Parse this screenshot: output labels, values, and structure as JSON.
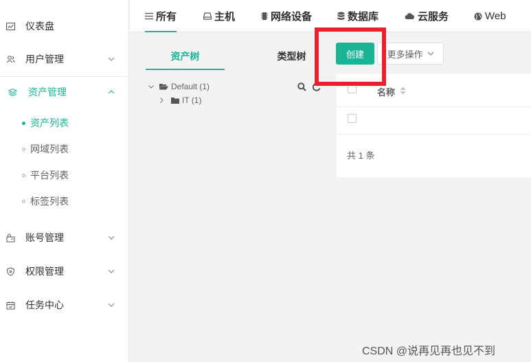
{
  "sidebar": {
    "items": [
      {
        "label": "仪表盘",
        "icon": "dashboard-icon",
        "expandable": false
      },
      {
        "label": "用户管理",
        "icon": "users-icon",
        "expandable": true
      },
      {
        "label": "资产管理",
        "icon": "layers-icon",
        "expandable": true,
        "expanded": true,
        "active": true
      },
      {
        "label": "账号管理",
        "icon": "account-icon",
        "expandable": true
      },
      {
        "label": "权限管理",
        "icon": "shield-icon",
        "expandable": true
      },
      {
        "label": "任务中心",
        "icon": "calendar-icon",
        "expandable": true
      }
    ],
    "subitems": [
      {
        "label": "资产列表",
        "active": true
      },
      {
        "label": "网域列表",
        "active": false
      },
      {
        "label": "平台列表",
        "active": false
      },
      {
        "label": "标签列表",
        "active": false
      }
    ]
  },
  "tabs": [
    {
      "label": "所有",
      "icon": "list-icon",
      "active": true
    },
    {
      "label": "主机",
      "icon": "host-icon"
    },
    {
      "label": "网络设备",
      "icon": "chip-icon"
    },
    {
      "label": "数据库",
      "icon": "database-icon"
    },
    {
      "label": "云服务",
      "icon": "cloud-icon"
    },
    {
      "label": "Web",
      "icon": "globe-icon"
    }
  ],
  "tree": {
    "subtabs": [
      "资产树",
      "类型树"
    ],
    "nodes": [
      {
        "label": "Default (1)",
        "expanded": true
      },
      {
        "label": "IT (1)",
        "expanded": false
      }
    ]
  },
  "toolbar": {
    "create_label": "创建",
    "more_label": "更多操作"
  },
  "table": {
    "columns": [
      "名称"
    ],
    "total": "共 1 条"
  },
  "watermark": "CSDN @说再见再也见不到",
  "colors": {
    "accent": "#1ab394",
    "highlight": "#e8212e"
  }
}
